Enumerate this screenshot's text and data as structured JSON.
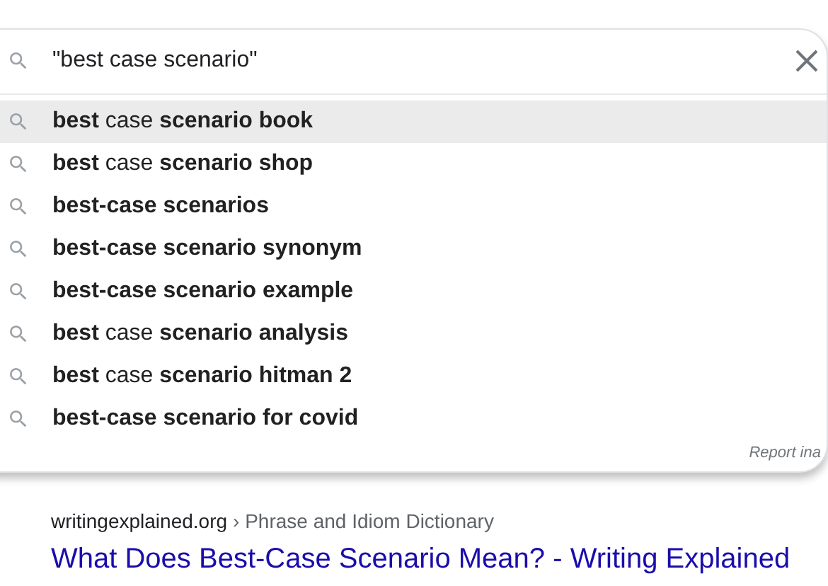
{
  "search": {
    "value": "\"best case scenario\""
  },
  "suggestions": [
    {
      "text": "**best** case **scenario book**",
      "selected": true
    },
    {
      "text": "**best** case **scenario shop**",
      "selected": false
    },
    {
      "text": "**best-case scenarios**",
      "selected": false
    },
    {
      "text": "**best-case scenario synonym**",
      "selected": false
    },
    {
      "text": "**best-case scenario example**",
      "selected": false
    },
    {
      "text": "**best** case **scenario analysis**",
      "selected": false
    },
    {
      "text": "**best** case **scenario hitman 2**",
      "selected": false
    },
    {
      "text": "**best-case scenario for covid**",
      "selected": false
    }
  ],
  "report_link": "Report ina",
  "result": {
    "site": "writingexplained.org",
    "breadcrumb": "› Phrase and Idiom Dictionary",
    "title": "What Does Best-Case Scenario Mean? - Writing Explained"
  }
}
